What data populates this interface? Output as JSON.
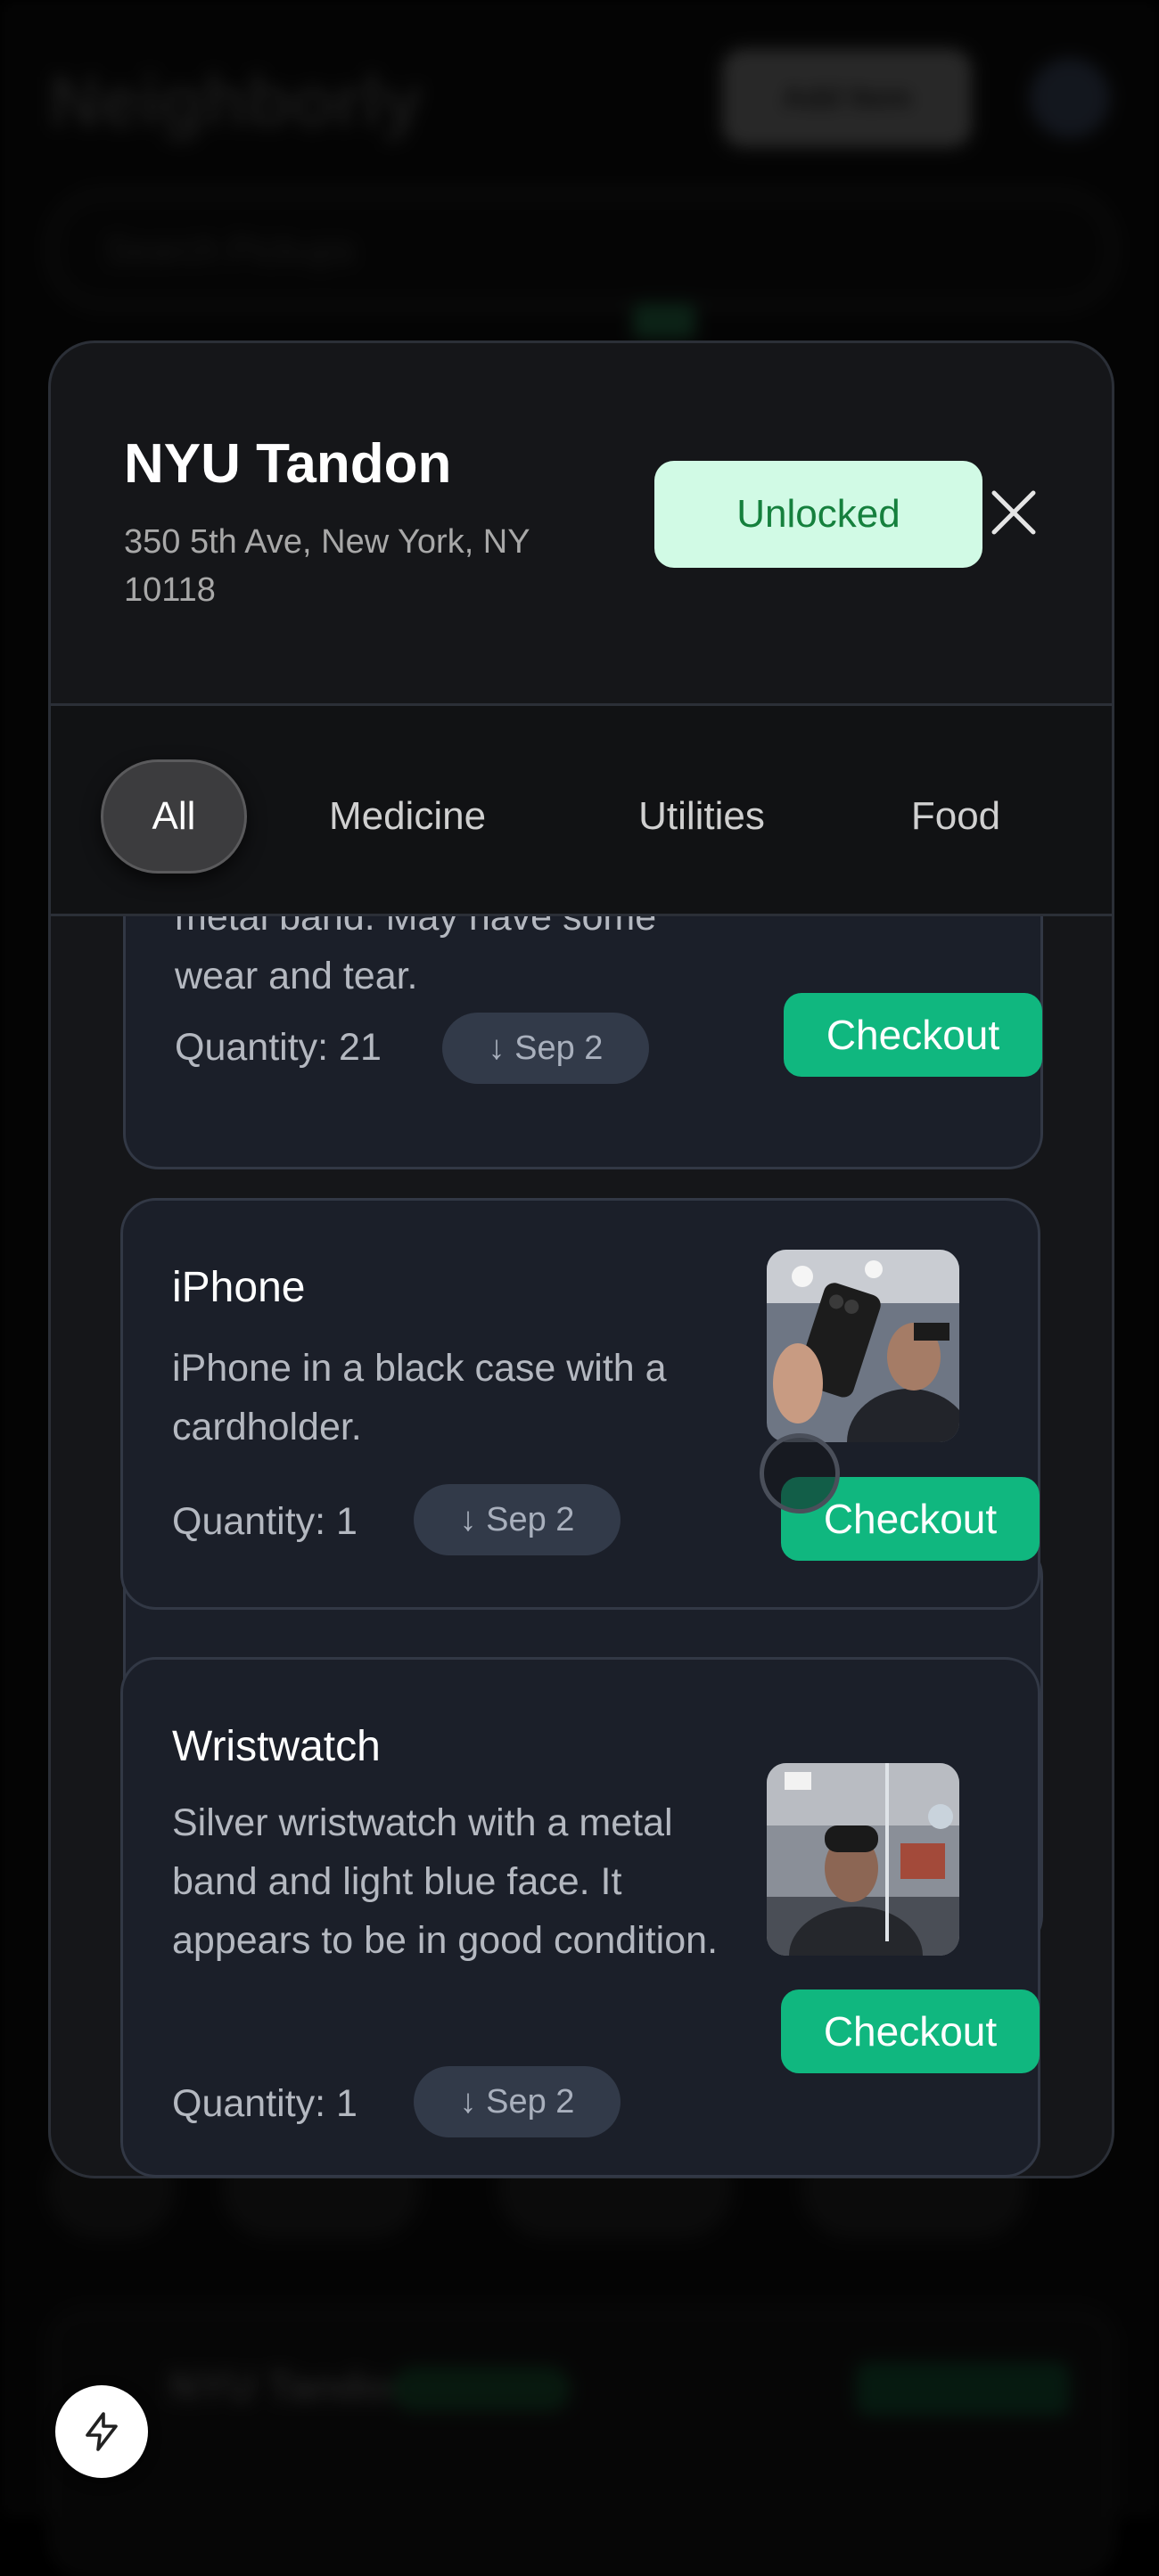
{
  "background": {
    "brand": "Neighborly",
    "add_button_label": "Add Item",
    "search_placeholder": "Search Pickups"
  },
  "location": {
    "name": "NYU Tandon",
    "address": "350 5th Ave, New York, NY 10118",
    "status_label": "Unlocked"
  },
  "tabs": [
    {
      "label": "All",
      "active": true
    },
    {
      "label": "Medicine",
      "active": false
    },
    {
      "label": "Utilities",
      "active": false
    },
    {
      "label": "Food",
      "active": false
    }
  ],
  "items": [
    {
      "title": "",
      "description": "metal band. May have some wear and tear.",
      "quantity_label": "Quantity: 21",
      "date_label": "↓ Sep 2",
      "checkout_label": "Checkout"
    },
    {
      "title": "iPhone",
      "description": "iPhone in a black case with a cardholder.",
      "quantity_label": "Quantity: 1",
      "date_label": "↓ Sep 2",
      "checkout_label": "Checkout"
    },
    {
      "title": "Wristwatch",
      "description": "Silver wristwatch with a metal band and light blue face. It appears to be in good condition.",
      "quantity_label": "Quantity: 1",
      "date_label": "↓ Sep 2",
      "checkout_label": "Checkout"
    }
  ],
  "icons": {
    "close": "close-icon",
    "fab": "lightning-icon"
  },
  "colors": {
    "accent": "#10b77f",
    "unlocked_bg": "#d1fae5",
    "unlocked_text": "#15803d",
    "card_bg": "#1b1f29"
  }
}
